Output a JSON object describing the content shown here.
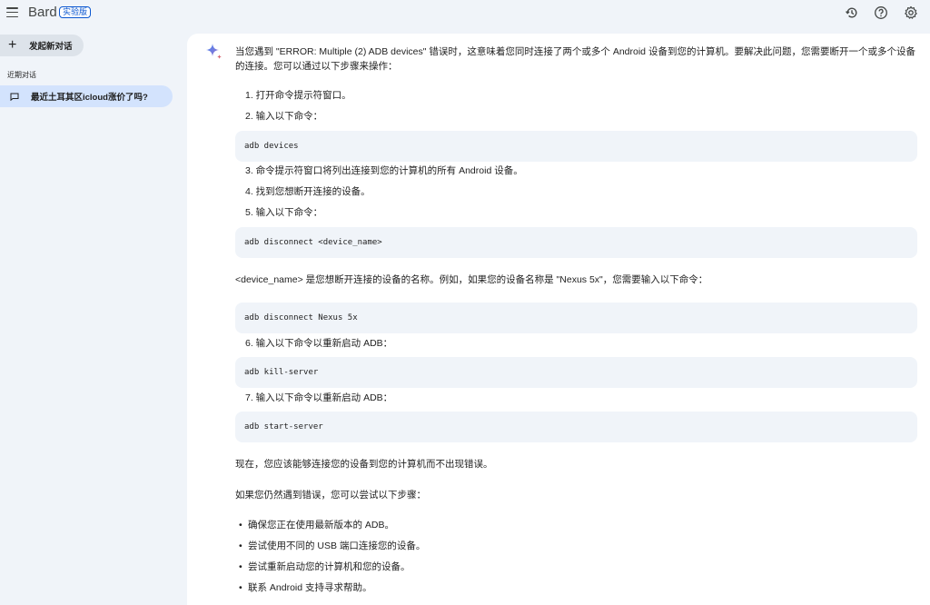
{
  "app": {
    "title": "Bard",
    "badge": "实验版"
  },
  "topbar_icons": [
    "history-icon",
    "help-icon",
    "settings-icon"
  ],
  "sidebar": {
    "new_chat_label": "发起新对话",
    "recent_title": "近期对话",
    "items": [
      {
        "label": "最近土耳其区icloud涨价了吗?"
      }
    ]
  },
  "response": {
    "intro": "当您遇到 \"ERROR: Multiple (2) ADB devices\" 错误时，这意味着您同时连接了两个或多个 Android 设备到您的计算机。要解决此问题，您需要断开一个或多个设备的连接。您可以通过以下步骤来操作：",
    "steps": [
      "1. 打开命令提示符窗口。",
      "2. 输入以下命令：",
      "3. 命令提示符窗口将列出连接到您的计算机的所有 Android 设备。",
      "4. 找到您想断开连接的设备。",
      "5. 输入以下命令：",
      "6. 输入以下命令以重新启动 ADB：",
      "7. 输入以下命令以重新启动 ADB："
    ],
    "code_blocks": [
      "adb devices",
      "adb disconnect <device_name>",
      "adb disconnect Nexus 5x",
      "adb kill-server",
      "adb start-server"
    ],
    "device_name_note": "<device_name> 是您想断开连接的设备的名称。例如，如果您的设备名称是 \"Nexus 5x\"，您需要输入以下命令：",
    "now_text": "现在，您应该能够连接您的设备到您的计算机而不出现错误。",
    "if_error_text": "如果您仍然遇到错误，您可以尝试以下步骤：",
    "bullets": [
      "确保您正在使用最新版本的 ADB。",
      "尝试使用不同的 USB 端口连接您的设备。",
      "尝试重新启动您的计算机和您的设备。",
      "联系 Android 支持寻求帮助。"
    ]
  },
  "colors": {
    "background": "#f0f4f9",
    "accent": "#0b57d0",
    "selected_item": "#d3e3fd",
    "code_bg": "#f0f4f9"
  }
}
